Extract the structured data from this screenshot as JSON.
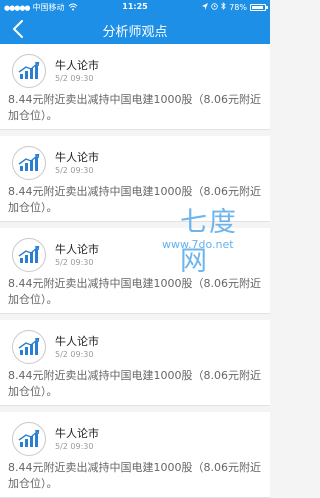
{
  "status_bar": {
    "carrier": "中国移动",
    "time": "11:25",
    "battery": "78%",
    "battery_level": 0.78
  },
  "nav": {
    "title": "分析师观点"
  },
  "items": [
    {
      "name": "牛人论市",
      "date": "5/2 09:30",
      "content": "8.44元附近卖出减持中国电建1000股（8.06元附近加仓位）。"
    },
    {
      "name": "牛人论市",
      "date": "5/2 09:30",
      "content": "8.44元附近卖出减持中国电建1000股（8.06元附近加仓位）。"
    },
    {
      "name": "牛人论市",
      "date": "5/2 09:30",
      "content": "8.44元附近卖出减持中国电建1000股（8.06元附近加仓位）。"
    },
    {
      "name": "牛人论市",
      "date": "5/2 09:30",
      "content": "8.44元附近卖出减持中国电建1000股（8.06元附近加仓位）。"
    },
    {
      "name": "牛人论市",
      "date": "5/2 09:30",
      "content": "8.44元附近卖出减持中国电建1000股（8.06元附近加仓位）。"
    }
  ],
  "watermark": {
    "title": "七度网",
    "url": "www.7do.net"
  },
  "colors": {
    "primary": "#1e8fe6",
    "logo_blue": "#2b7fd2"
  }
}
